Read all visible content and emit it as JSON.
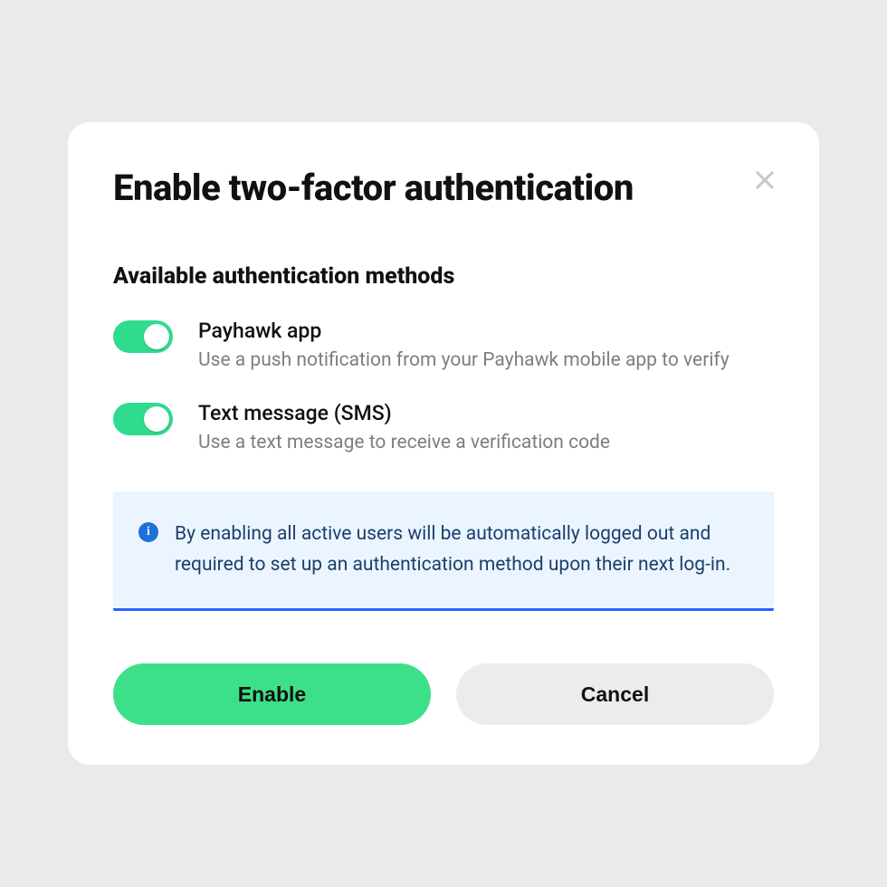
{
  "dialog": {
    "title": "Enable two-factor authentication",
    "section_heading": "Available authentication methods",
    "methods": [
      {
        "title": "Payhawk app",
        "description": "Use a push notification from your Payhawk mobile app to verify",
        "enabled": true
      },
      {
        "title": "Text message (SMS)",
        "description": "Use a text message to receive a verification code",
        "enabled": true
      }
    ],
    "info_banner": {
      "text": "By enabling all active users will be automatically logged out and required to set up an authentication method upon their next log-in."
    },
    "buttons": {
      "primary": "Enable",
      "secondary": "Cancel"
    }
  },
  "colors": {
    "accent_green": "#3be088",
    "toggle_green": "#2fdc8d",
    "info_bg": "#ebf5ff",
    "info_accent": "#2962ff",
    "info_text": "#1c3f6b"
  }
}
